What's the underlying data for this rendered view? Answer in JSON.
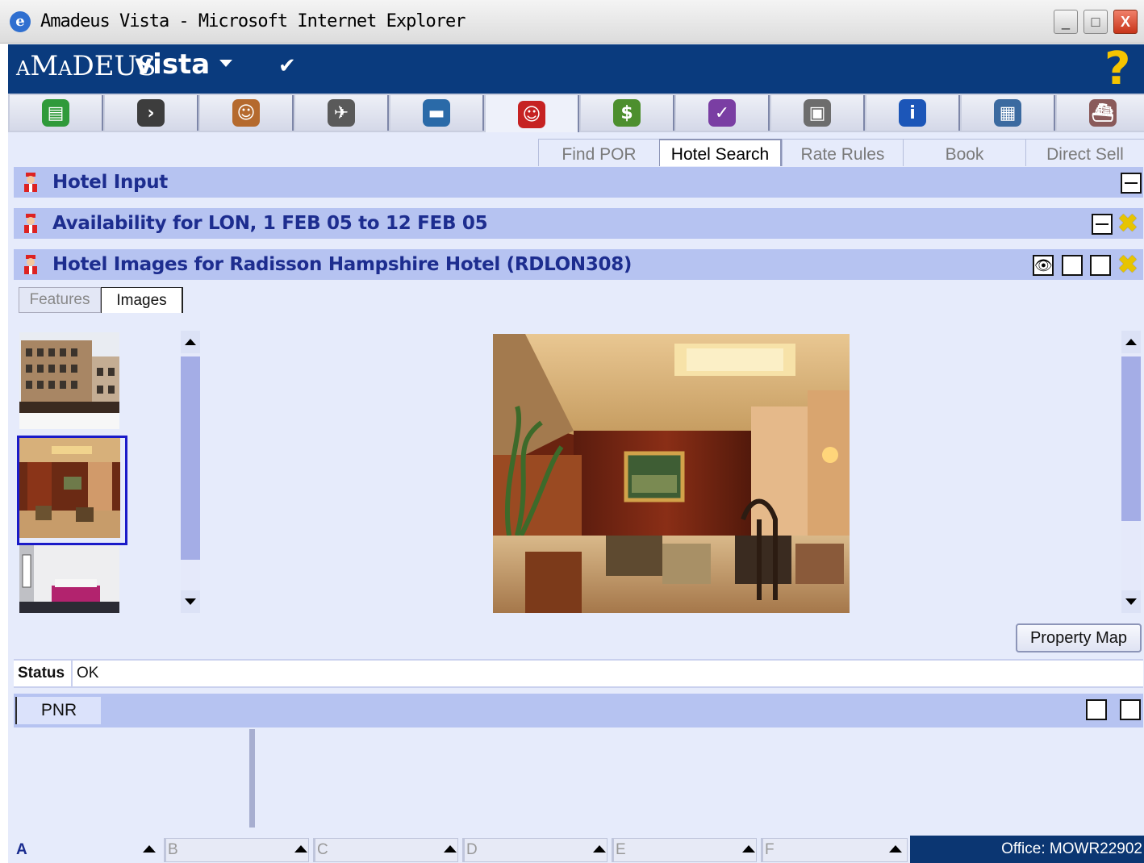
{
  "window": {
    "title": "Amadeus Vista - Microsoft Internet Explorer",
    "controls": {
      "minimize": "_",
      "maximize": "□",
      "close": "X"
    }
  },
  "brand": {
    "name_light": "aMaDEUS",
    "name_bold": "vista",
    "help": "?"
  },
  "modules": [
    {
      "icon": "green-book-icon",
      "color": "#2f9a3a",
      "glyph": "▤"
    },
    {
      "icon": "terminal-icon",
      "color": "#3d3d3d",
      "glyph": "›"
    },
    {
      "icon": "agent-person-icon",
      "color": "#b56a2e",
      "glyph": "☺"
    },
    {
      "icon": "airplane-icon",
      "color": "#5a5a5a",
      "glyph": "✈"
    },
    {
      "icon": "car-icon",
      "color": "#2a6aa8",
      "glyph": "▬"
    },
    {
      "icon": "hotel-bellboy-icon",
      "color": "#c62222",
      "glyph": "☺",
      "active": true
    },
    {
      "icon": "money-icon",
      "color": "#4d8f2e",
      "glyph": "$"
    },
    {
      "icon": "ticket-check-icon",
      "color": "#7a3ea3",
      "glyph": "✓"
    },
    {
      "icon": "printer-icon",
      "color": "#6d6d6d",
      "glyph": "▣"
    },
    {
      "icon": "info-icon",
      "color": "#1c56b8",
      "glyph": "i"
    },
    {
      "icon": "rail-car-icon",
      "color": "#3b6aa0",
      "glyph": "▦"
    },
    {
      "icon": "cruise-ship-icon",
      "color": "#8a5a5a",
      "glyph": "⛴"
    }
  ],
  "subtabs": [
    {
      "label": "Find POR",
      "active": false
    },
    {
      "label": "Hotel Search",
      "active": true
    },
    {
      "label": "Rate Rules",
      "active": false
    },
    {
      "label": "Book",
      "active": false
    },
    {
      "label": "Direct Sell",
      "active": false
    }
  ],
  "panels": {
    "hotel_input": {
      "title": "Hotel Input"
    },
    "availability": {
      "title": "Availability for LON, 1 FEB 05 to 12 FEB 05"
    },
    "images": {
      "title": "Hotel Images for Radisson Hampshire Hotel (RDLON308)"
    }
  },
  "image_tabs": [
    {
      "label": "Features",
      "active": false
    },
    {
      "label": "Images",
      "active": true
    }
  ],
  "thumbnails": [
    {
      "name": "hotel-exterior-thumbnail",
      "selected": false
    },
    {
      "name": "hotel-lobby-thumbnail",
      "selected": true
    },
    {
      "name": "hotel-bedroom-thumbnail",
      "selected": false
    }
  ],
  "main_image": {
    "name": "hotel-lobby-image"
  },
  "property_map_button": "Property Map",
  "status": {
    "label": "Status",
    "value": "OK"
  },
  "pnr": {
    "tab": "PNR"
  },
  "bottom_segments": [
    "A",
    "B",
    "C",
    "D",
    "E",
    "F"
  ],
  "office": "Office: MOWR22902"
}
